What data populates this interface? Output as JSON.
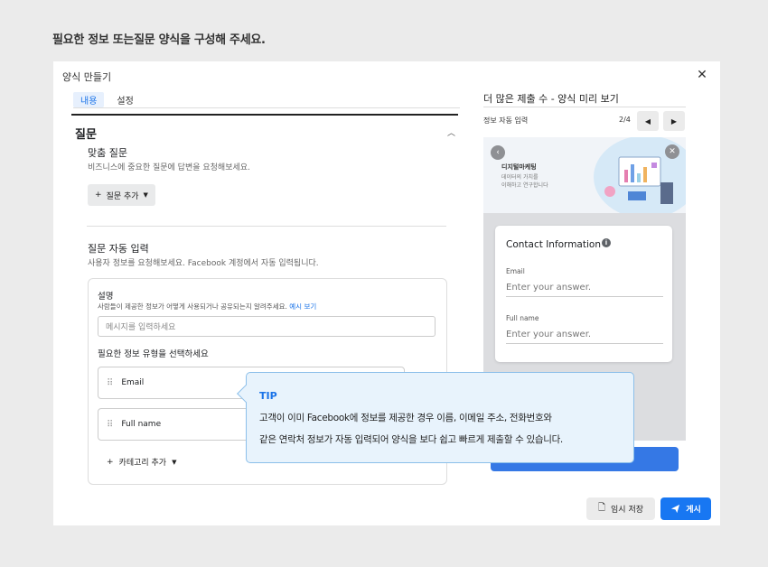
{
  "instruction": "필요한 정보 또는질문 양식을 구성해 주세요.",
  "modal": {
    "title": "양식 만들기",
    "tabs": [
      "내용",
      "설정"
    ]
  },
  "questions": {
    "section_title": "질문",
    "custom": {
      "title": "맞춤 질문",
      "desc": "비즈니스에 중요한 질문에 답변을 요청해보세요.",
      "add_button": "질문 추가"
    },
    "autofill": {
      "title": "질문 자동 입력",
      "desc": "사용자 정보를 요청해보세요. Facebook 계정에서 자동 입력됩니다.",
      "card": {
        "label": "설명",
        "help": "사람들이 제공한 정보가 어떻게 사용되거나 공유되는지 알려주세요.",
        "example_link": "예시 보기",
        "placeholder": "메시지를 입력하세요",
        "select_label": "필요한 정보 유형을 선택하세요",
        "fields": [
          "Email",
          "Full name"
        ],
        "add_category": "카테고리 추가"
      }
    }
  },
  "preview": {
    "title": "더 많은 제출 수 - 양식 미리 보기",
    "subtitle": "정보 자동 입력",
    "pager": "2/4",
    "banner": {
      "title": "디지털마케팅",
      "lines": [
        "데이터의 가치를",
        "이해하고 연구합니다"
      ]
    },
    "form": {
      "title": "Contact Information",
      "fields": [
        {
          "label": "Email",
          "placeholder": "Enter your answer."
        },
        {
          "label": "Full name",
          "placeholder": "Enter your answer."
        }
      ]
    }
  },
  "tip": {
    "title": "TIP",
    "lines": [
      "고객이 이미 Facebook에 정보를 제공한 경우 이름, 이메일 주소, 전화번호와",
      "같은 연락처 정보가 자동 입력되어 양식을 보다 쉽고 빠르게 제출할 수 있습니다."
    ]
  },
  "footer": {
    "save_label": "임시 저장",
    "post_label": "게시"
  },
  "colors": {
    "accent": "#1877f2",
    "tip_border": "#8cbfea",
    "tip_bg": "#e8f3fc"
  }
}
